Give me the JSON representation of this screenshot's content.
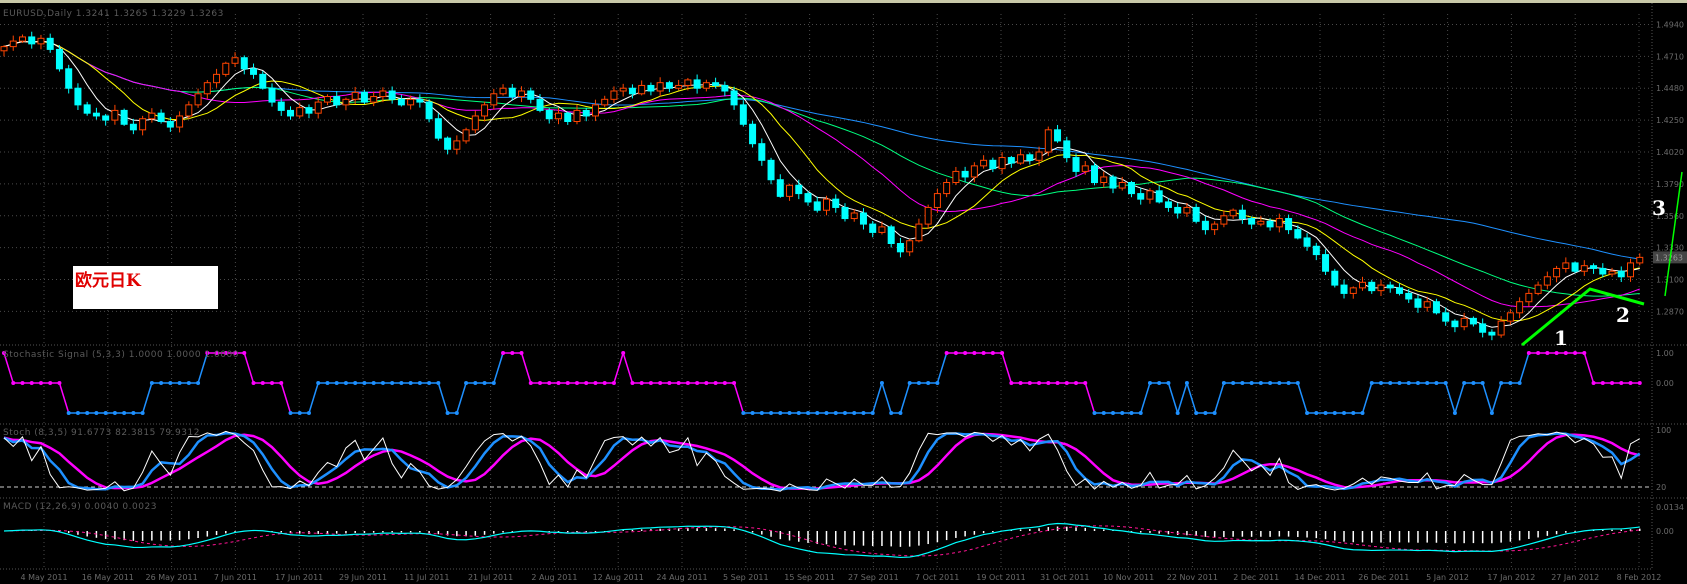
{
  "header": {
    "main_title": "EURUSD,Daily  1.3241 1.3265 1.3229 1.3263",
    "signal_title": "Stochastic Signal (5,3,3)  1.0000 1.0000 1.0000",
    "stoch_title": "Stoch (8,3,5)  91.6773  82.3815  79.9312",
    "macd_title": "MACD (12,26,9)  0.0040 0.0023"
  },
  "note_box": "欧元日K",
  "annotations": [
    "1",
    "2",
    "3"
  ],
  "current_price_label": "1.3263",
  "colors": {
    "bull": "#ff4500",
    "bear": "#00ffff",
    "ma5": "#ffffff",
    "ma10": "#ffff00",
    "ma20": "#ff00ff",
    "ma30": "#00ff7f",
    "ma60": "#1e90ff",
    "trend": "#00ff00",
    "grid": "#4a4a4a"
  },
  "chart_data": {
    "type": "candlestick",
    "symbol": "EURUSD",
    "timeframe": "Daily",
    "closes": [
      1.478,
      1.482,
      1.485,
      1.48,
      1.484,
      1.476,
      1.462,
      1.448,
      1.436,
      1.43,
      1.428,
      1.425,
      1.432,
      1.422,
      1.418,
      1.426,
      1.43,
      1.424,
      1.42,
      1.428,
      1.436,
      1.444,
      1.452,
      1.458,
      1.466,
      1.47,
      1.462,
      1.458,
      1.448,
      1.438,
      1.432,
      1.428,
      1.434,
      1.43,
      1.438,
      1.442,
      1.436,
      1.44,
      1.445,
      1.438,
      1.442,
      1.446,
      1.44,
      1.436,
      1.44,
      1.438,
      1.426,
      1.412,
      1.404,
      1.41,
      1.418,
      1.428,
      1.436,
      1.444,
      1.448,
      1.442,
      1.446,
      1.44,
      1.432,
      1.426,
      1.43,
      1.424,
      1.432,
      1.428,
      1.436,
      1.44,
      1.446,
      1.448,
      1.444,
      1.45,
      1.446,
      1.452,
      1.448,
      1.45,
      1.454,
      1.448,
      1.452,
      1.45,
      1.446,
      1.436,
      1.422,
      1.408,
      1.396,
      1.382,
      1.37,
      1.378,
      1.372,
      1.366,
      1.36,
      1.368,
      1.362,
      1.354,
      1.358,
      1.35,
      1.344,
      1.348,
      1.336,
      1.33,
      1.338,
      1.35,
      1.362,
      1.372,
      1.38,
      1.388,
      1.384,
      1.392,
      1.396,
      1.39,
      1.398,
      1.394,
      1.4,
      1.396,
      1.402,
      1.418,
      1.41,
      1.398,
      1.388,
      1.392,
      1.38,
      1.384,
      1.376,
      1.38,
      1.372,
      1.368,
      1.374,
      1.366,
      1.362,
      1.358,
      1.362,
      1.352,
      1.346,
      1.35,
      1.356,
      1.36,
      1.354,
      1.35,
      1.352,
      1.348,
      1.354,
      1.346,
      1.34,
      1.334,
      1.328,
      1.316,
      1.306,
      1.3,
      1.304,
      1.308,
      1.302,
      1.306,
      1.304,
      1.3,
      1.296,
      1.29,
      1.294,
      1.286,
      1.28,
      1.276,
      1.282,
      1.278,
      1.272,
      1.27,
      1.28,
      1.286,
      1.294,
      1.3,
      1.306,
      1.312,
      1.318,
      1.322,
      1.316,
      1.32,
      1.318,
      1.314,
      1.316,
      1.312,
      1.322,
      1.326
    ],
    "ylim": [
      1.27,
      1.49
    ],
    "moving_averages": [
      5,
      10,
      20,
      30,
      60
    ],
    "price_ticks": [
      "1.4940",
      "1.4710",
      "1.4480",
      "1.4250",
      "1.4020",
      "1.3790",
      "1.3560",
      "1.3330",
      "1.3100",
      "1.2870"
    ],
    "date_ticks": [
      "4 May 2011",
      "16 May 2011",
      "26 May 2011",
      "7 Jun 2011",
      "17 Jun 2011",
      "29 Jun 2011",
      "11 Jul 2011",
      "21 Jul 2011",
      "2 Aug 2011",
      "12 Aug 2011",
      "24 Aug 2011",
      "5 Sep 2011",
      "15 Sep 2011",
      "27 Sep 2011",
      "7 Oct 2011",
      "19 Oct 2011",
      "31 Oct 2011",
      "10 Nov 2011",
      "22 Nov 2011",
      "2 Dec 2011",
      "14 Dec 2011",
      "26 Dec 2011",
      "5 Jan 2012",
      "17 Jan 2012",
      "27 Jan 2012",
      "8 Feb 2012"
    ],
    "signal_ticks": [
      "1.00",
      "0.00"
    ],
    "stoch_ticks": [
      "100",
      "20"
    ],
    "macd_ticks": [
      "0.0134",
      "0.00"
    ]
  }
}
